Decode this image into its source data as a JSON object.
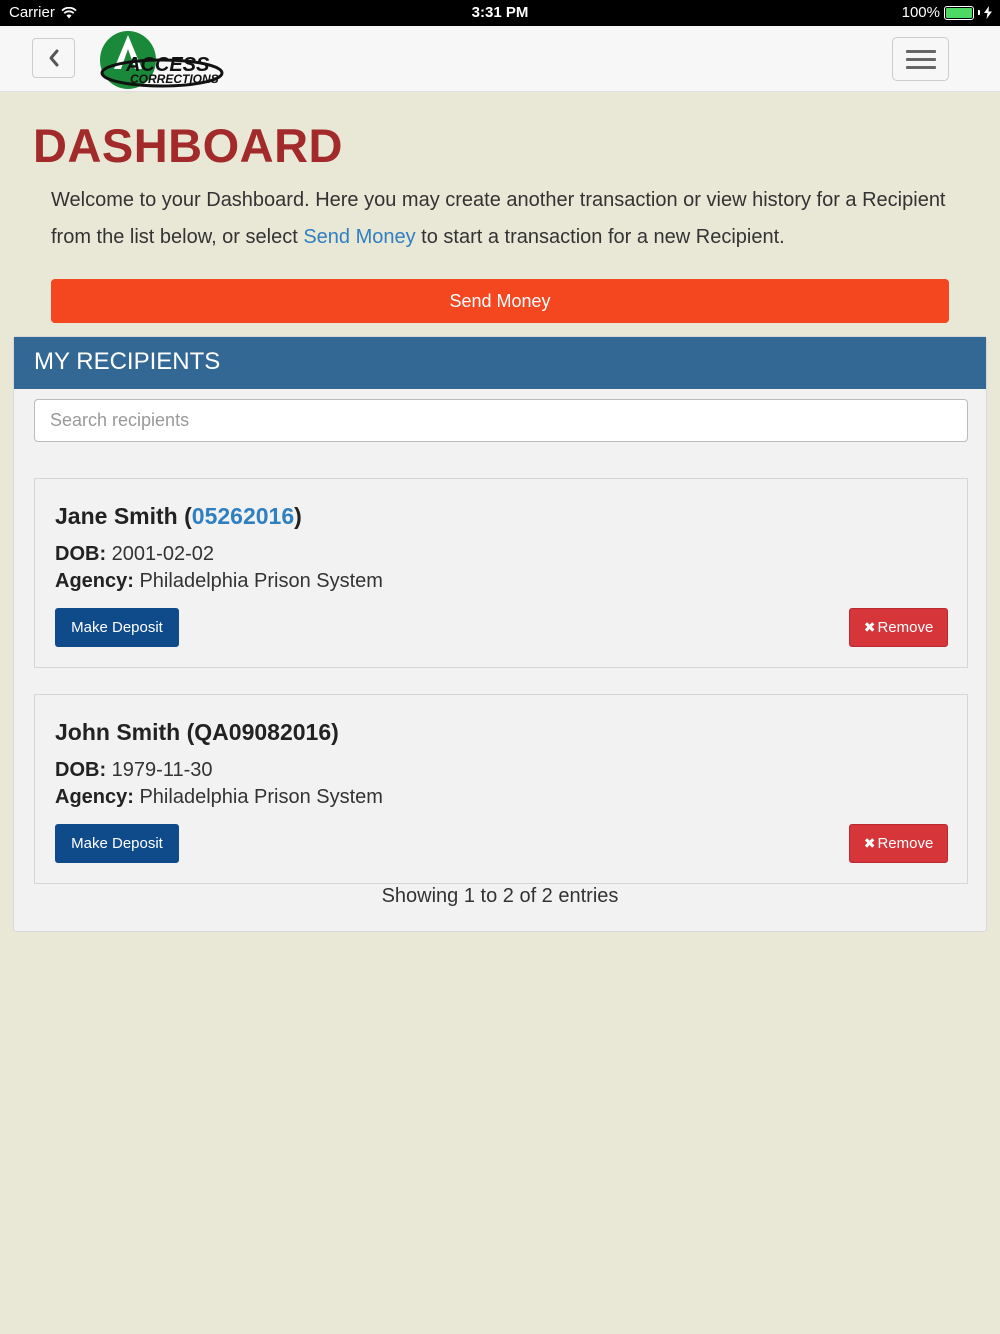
{
  "status_bar": {
    "carrier": "Carrier",
    "time": "3:31 PM",
    "battery": "100%"
  },
  "navbar": {
    "logo_text_top": "ACCESS",
    "logo_text_bottom": "CORRECTIONS"
  },
  "page": {
    "title": "DASHBOARD",
    "intro_before": "Welcome to your Dashboard. Here you may create another transaction or view history for a Recipient from the list below, or select ",
    "intro_link": "Send Money",
    "intro_after": " to start a transaction for a new Recipient.",
    "send_button": "Send Money"
  },
  "recipients": {
    "heading": "MY RECIPIENTS",
    "search_placeholder": "Search recipients",
    "dob_label": "DOB:",
    "agency_label": "Agency:",
    "deposit_label": "Make Deposit",
    "remove_label": "Remove",
    "items": [
      {
        "name": "Jane Smith",
        "id": "05262016",
        "id_is_link": true,
        "dob": "2001-02-02",
        "agency": "Philadelphia Prison System"
      },
      {
        "name": "John Smith",
        "id": "QA09082016",
        "id_is_link": false,
        "dob": "1979-11-30",
        "agency": "Philadelphia Prison System"
      }
    ],
    "entries_info": "Showing 1 to 2 of 2 entries"
  },
  "colors": {
    "title_red": "#a22a2a",
    "send_orange": "#f4461f",
    "panel_blue": "#336895",
    "deposit_blue": "#0f4a8a",
    "remove_red": "#d6363a",
    "link_blue": "#2f7fc1",
    "logo_green": "#1a8a3a"
  },
  "icons": {
    "back": "chevron-left-icon",
    "menu": "hamburger-icon",
    "wifi": "wifi-icon",
    "battery": "battery-icon",
    "remove": "close-icon"
  }
}
